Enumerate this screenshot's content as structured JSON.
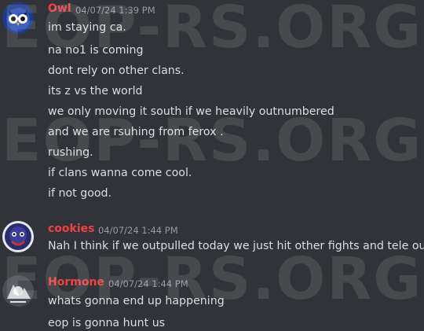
{
  "watermark": "EOP-RS.ORG",
  "messages": [
    {
      "author": "Owl",
      "author_color": "#ed4245",
      "timestamp": "04/07/24 1:39 PM",
      "avatar_icon": "owl-avatar-icon",
      "lines": [
        "im staying ca.",
        "na no1 is coming",
        "dont rely on other clans.",
        "its z vs the world",
        "we only moving it south if we heavily outnumbered",
        "and we are rsuhing from ferox .",
        "rushing.",
        "if clans wanna come cool.",
        "if not good."
      ]
    },
    {
      "author": "cookies",
      "author_color": "#ed4245",
      "timestamp": "04/07/24 1:44 PM",
      "avatar_icon": "cookies-avatar-icon",
      "lines": [
        "Nah I think if we outpulled today we just hit other fights and tele out"
      ]
    },
    {
      "author": "Hormone",
      "author_color": "#ed4245",
      "timestamp": "04/07/24 1:44 PM",
      "avatar_icon": "hormone-avatar-icon",
      "lines": [
        "whats gonna end up happening",
        "eop is gonna hunt us"
      ]
    }
  ]
}
